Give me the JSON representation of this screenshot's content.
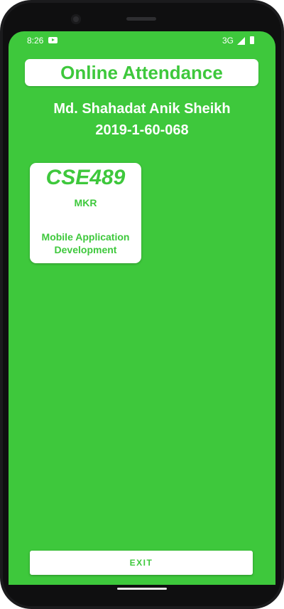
{
  "status_bar": {
    "time": "8:26",
    "network": "3G",
    "notification_icon": "youtube-icon",
    "signal_icon": "signal-icon",
    "battery_icon": "battery-icon"
  },
  "app": {
    "title": "Online Attendance",
    "accent_color": "#3ec83c"
  },
  "student": {
    "name": "Md. Shahadat Anik Sheikh",
    "id": "2019-1-60-068"
  },
  "courses": [
    {
      "code": "CSE489",
      "teacher": "MKR",
      "name": "Mobile Application Development"
    }
  ],
  "exit_button": {
    "label": "EXIT"
  }
}
